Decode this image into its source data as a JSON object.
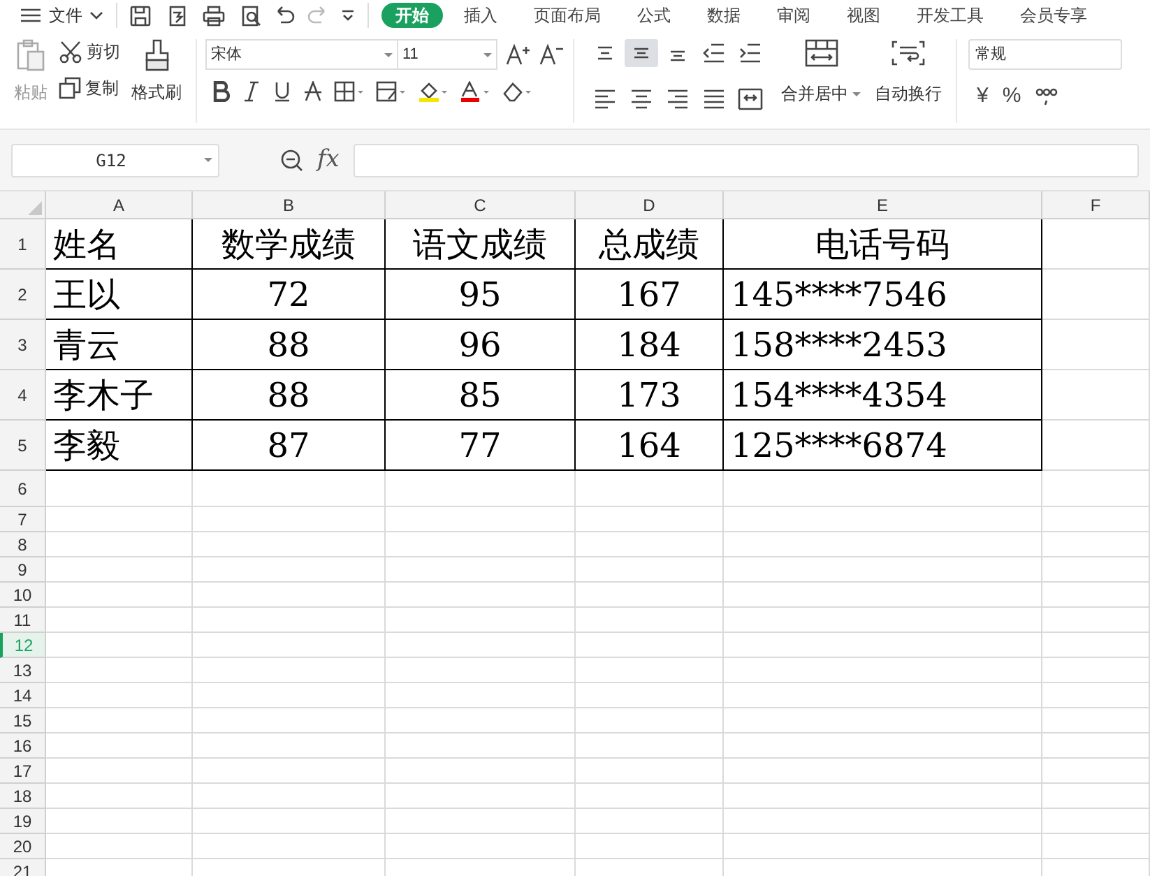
{
  "title_bar": {
    "menu": "文件",
    "tabs": [
      {
        "label": "开始",
        "selected": true
      },
      {
        "label": "插入",
        "selected": false
      },
      {
        "label": "页面布局",
        "selected": false
      },
      {
        "label": "公式",
        "selected": false
      },
      {
        "label": "数据",
        "selected": false
      },
      {
        "label": "审阅",
        "selected": false
      },
      {
        "label": "视图",
        "selected": false
      },
      {
        "label": "开发工具",
        "selected": false
      },
      {
        "label": "会员专享",
        "selected": false
      }
    ]
  },
  "ribbon": {
    "clipboard": {
      "paste": "粘贴",
      "cut": "剪切",
      "copy": "复制",
      "format_painter": "格式刷"
    },
    "font": {
      "name": "宋体",
      "size": "11"
    },
    "vertical_align": [
      {
        "kind": "top",
        "selected": false
      },
      {
        "kind": "middle",
        "selected": true
      },
      {
        "kind": "bottom",
        "selected": false
      }
    ],
    "alignment": {
      "merge": "合并居中",
      "wrap": "自动换行"
    },
    "number": {
      "format": "常规",
      "symbols": [
        "¥",
        "%"
      ]
    }
  },
  "formula_bar": {
    "cell_ref": "G12",
    "fx": "fx"
  },
  "sheet": {
    "columns": [
      "A",
      "B",
      "C",
      "D",
      "E",
      "F"
    ],
    "row_headers": [
      {
        "label": "1",
        "selected": false
      },
      {
        "label": "2",
        "selected": false
      },
      {
        "label": "3",
        "selected": false
      },
      {
        "label": "4",
        "selected": false
      },
      {
        "label": "5",
        "selected": false
      },
      {
        "label": "6",
        "selected": false
      },
      {
        "label": "7",
        "selected": false
      },
      {
        "label": "8",
        "selected": false
      },
      {
        "label": "9",
        "selected": false
      },
      {
        "label": "10",
        "selected": false
      },
      {
        "label": "11",
        "selected": false
      },
      {
        "label": "12",
        "selected": true
      },
      {
        "label": "13",
        "selected": false
      },
      {
        "label": "14",
        "selected": false
      },
      {
        "label": "15",
        "selected": false
      },
      {
        "label": "16",
        "selected": false
      },
      {
        "label": "17",
        "selected": false
      },
      {
        "label": "18",
        "selected": false
      },
      {
        "label": "19",
        "selected": false
      },
      {
        "label": "20",
        "selected": false
      },
      {
        "label": "21",
        "selected": false
      }
    ],
    "rows": [
      [
        "姓名",
        "数学成绩",
        "语文成绩",
        "总成绩",
        "电话号码"
      ],
      [
        "王以",
        "72",
        "95",
        "167",
        "145****7546"
      ],
      [
        "青云",
        "88",
        "96",
        "184",
        "158****2453"
      ],
      [
        "李木子",
        "88",
        "85",
        "173",
        "154****4354"
      ],
      [
        "李毅",
        "87",
        "77",
        "164",
        "125****6874"
      ]
    ]
  }
}
